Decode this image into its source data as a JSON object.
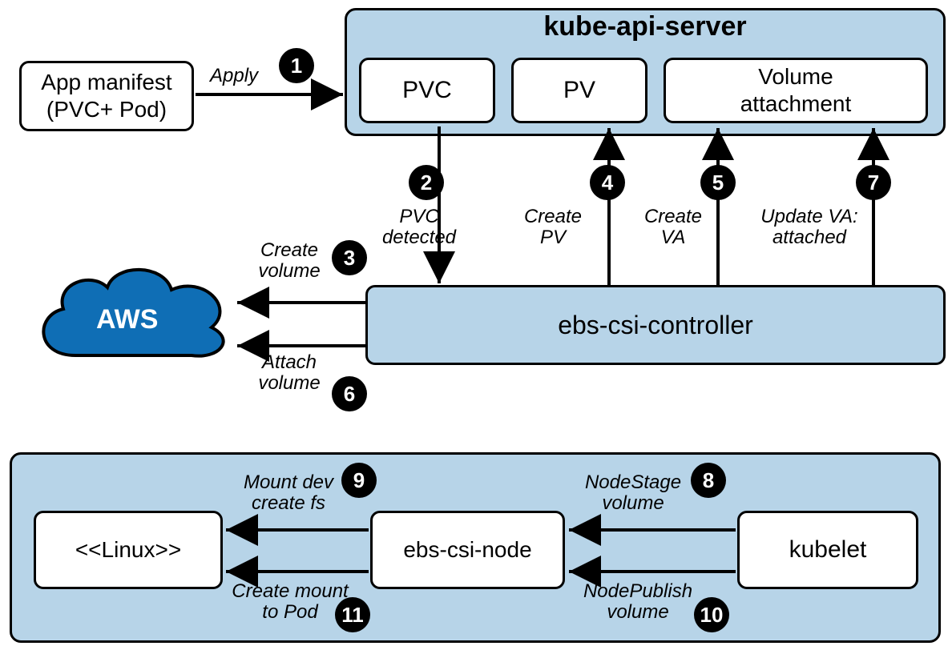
{
  "boxes": {
    "app_manifest": "App manifest\n(PVC+ Pod)",
    "pvc": "PVC",
    "pv": "PV",
    "volume_attachment": "Volume\nattachment",
    "ebs_csi_controller": "ebs-csi-controller",
    "linux": "<<Linux>>",
    "ebs_csi_node": "ebs-csi-node",
    "kubelet": "kubelet"
  },
  "groups": {
    "kube_api_server": "kube-api-server"
  },
  "cloud": {
    "aws": "AWS"
  },
  "labels": {
    "apply": "Apply",
    "pvc_detected": "PVC\ndetected",
    "create_volume": "Create\nvolume",
    "create_pv": "Create\nPV",
    "create_va": "Create\nVA",
    "attach_volume": "Attach\nvolume",
    "update_va": "Update VA:\nattached",
    "nodestage": "NodeStage\nvolume",
    "mount_dev": "Mount dev\ncreate fs",
    "nodepublish": "NodePublish\nvolume",
    "create_mount": "Create mount\nto Pod"
  },
  "badges": {
    "b1": "1",
    "b2": "2",
    "b3": "3",
    "b4": "4",
    "b5": "5",
    "b6": "6",
    "b7": "7",
    "b8": "8",
    "b9": "9",
    "b10": "10",
    "b11": "11"
  }
}
